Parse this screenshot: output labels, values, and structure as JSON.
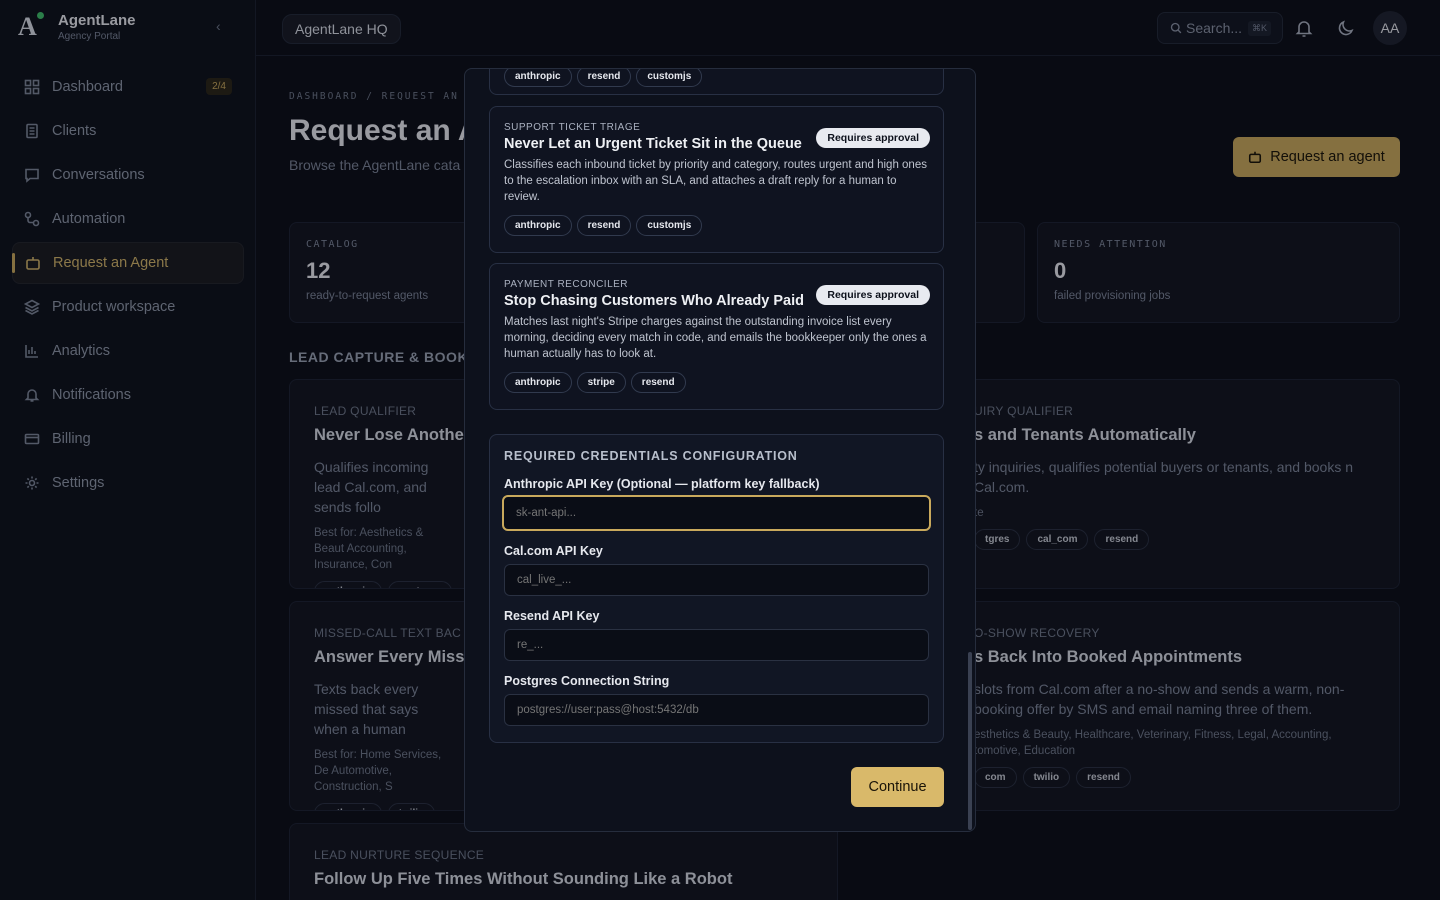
{
  "brand": {
    "name": "AgentLane",
    "subtitle": "Agency Portal"
  },
  "sidebar": {
    "items": [
      {
        "label": "Dashboard",
        "icon": "dashboard-icon",
        "badge": "2/4"
      },
      {
        "label": "Clients",
        "icon": "clients-icon"
      },
      {
        "label": "Conversations",
        "icon": "chat-icon"
      },
      {
        "label": "Automation",
        "icon": "automation-icon"
      },
      {
        "label": "Request an Agent",
        "icon": "bot-icon",
        "active": true
      },
      {
        "label": "Product workspace",
        "icon": "layers-icon"
      },
      {
        "label": "Analytics",
        "icon": "chart-icon"
      },
      {
        "label": "Notifications",
        "icon": "bell-icon"
      },
      {
        "label": "Billing",
        "icon": "card-icon"
      },
      {
        "label": "Settings",
        "icon": "gear-icon"
      }
    ]
  },
  "topbar": {
    "workspace": "AgentLane HQ",
    "search_placeholder": "Search...",
    "shortcut": "⌘K",
    "avatar_initials": "AA"
  },
  "page": {
    "breadcrumb": "DASHBOARD  /  REQUEST AN",
    "title": "Request an A",
    "subtitle": "Browse the AgentLane cata",
    "request_button": "Request an agent",
    "stats": [
      {
        "label": "CATALOG",
        "value": "12",
        "desc": "ready-to-request agents"
      },
      {
        "label": "NEEDS ATTENTION",
        "value": "0",
        "desc": "failed provisioning jobs"
      }
    ],
    "section": "LEAD CAPTURE & BOOKI",
    "cards": [
      {
        "kicker": "LEAD QUALIFIER",
        "title": "Never Lose Another L",
        "desc": "Qualifies incoming lead Cal.com, and sends follo",
        "best": "Best for: Aesthetics & Beaut Accounting, Insurance, Con",
        "chips": [
          "anthropic",
          "postgres"
        ]
      },
      {
        "kicker": "UIRY QUALIFIER",
        "title": "s and Tenants Automatically",
        "desc": "ty inquiries, qualifies potential buyers or tenants, and books n Cal.com.",
        "best": "te",
        "chips": [
          "tgres",
          "cal_com",
          "resend"
        ]
      },
      {
        "kicker": "MISSED-CALL TEXT BAC",
        "title": "Answer Every Missed",
        "desc": "Texts back every missed that says when a human",
        "best": "Best for: Home Services, De Automotive, Construction, S",
        "chips": [
          "anthropic",
          "twilio"
        ]
      },
      {
        "kicker": "O-SHOW RECOVERY",
        "title": "s Back Into Booked Appointments",
        "desc": "slots from Cal.com after a no-show and sends a warm, non- booking offer by SMS and email naming three of them.",
        "best": "esthetics & Beauty, Healthcare, Veterinary, Fitness, Legal, Accounting, tomotive, Education",
        "chips": [
          "com",
          "twilio",
          "resend"
        ]
      },
      {
        "kicker": "LEAD NURTURE SEQUENCE",
        "title": "Follow Up Five Times Without Sounding Like a Robot"
      }
    ]
  },
  "modal": {
    "top_chips": [
      "anthropic",
      "resend",
      "customjs"
    ],
    "agents": [
      {
        "kicker": "SUPPORT TICKET TRIAGE",
        "title": "Never Let an Urgent Ticket Sit in the Queue",
        "badge": "Requires approval",
        "desc": "Classifies each inbound ticket by priority and category, routes urgent and high ones to the escalation inbox with an SLA, and attaches a draft reply for a human to review.",
        "chips": [
          "anthropic",
          "resend",
          "customjs"
        ]
      },
      {
        "kicker": "PAYMENT RECONCILER",
        "title": "Stop Chasing Customers Who Already Paid",
        "badge": "Requires approval",
        "desc": "Matches last night's Stripe charges against the outstanding invoice list every morning, deciding every match in code, and emails the bookkeeper only the ones a human actually has to look at.",
        "chips": [
          "anthropic",
          "stripe",
          "resend"
        ]
      }
    ],
    "credentials": {
      "title": "REQUIRED CREDENTIALS CONFIGURATION",
      "fields": [
        {
          "label": "Anthropic API Key (Optional — platform key fallback)",
          "placeholder": "sk-ant-api..."
        },
        {
          "label": "Cal.com API Key",
          "placeholder": "cal_live_..."
        },
        {
          "label": "Resend API Key",
          "placeholder": "re_..."
        },
        {
          "label": "Postgres Connection String",
          "placeholder": "postgres://user:pass@host:5432/db"
        }
      ]
    },
    "continue_label": "Continue"
  },
  "colors": {
    "accent": "#c9a95c",
    "background": "#0b0e17",
    "card": "#111520"
  }
}
